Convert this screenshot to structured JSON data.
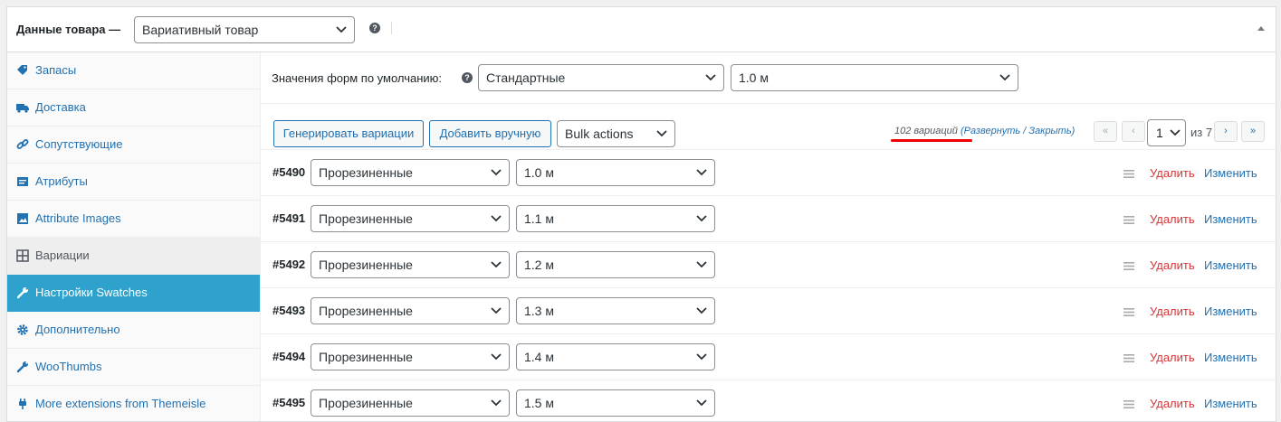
{
  "header": {
    "title": "Данные товара —",
    "type_select": "Вариативный товар",
    "help_icon": "help-icon",
    "collapse_icon": "collapse-arrow-icon"
  },
  "sidebar": {
    "items": [
      {
        "label": "Запасы",
        "icon": "inventory-tag-icon"
      },
      {
        "label": "Доставка",
        "icon": "truck-icon"
      },
      {
        "label": "Сопутствующие",
        "icon": "link-icon"
      },
      {
        "label": "Атрибуты",
        "icon": "attributes-list-icon"
      },
      {
        "label": "Attribute Images",
        "icon": "image-icon"
      },
      {
        "label": "Вариации",
        "icon": "grid-icon"
      },
      {
        "label": "Настройки Swatches",
        "icon": "wrench-icon"
      },
      {
        "label": "Дополнительно",
        "icon": "gear-icon"
      },
      {
        "label": "WooThumbs",
        "icon": "wrench-icon"
      },
      {
        "label": "More extensions from Themeisle",
        "icon": "plug-icon"
      }
    ]
  },
  "defaults": {
    "label": "Значения форм по умолчанию:",
    "select1": "Стандартные",
    "select2": "1.0 м"
  },
  "toolbar": {
    "generate_label": "Генерировать вариации",
    "add_label": "Добавить вручную",
    "bulk_label": "Bulk actions",
    "count_text": "102 вариаций",
    "expand_open": "(",
    "expand_label": "Развернуть",
    "expand_sep": " / ",
    "close_label": "Закрыть",
    "expand_close": ")",
    "first": "«",
    "prev": "‹",
    "page": "1",
    "of_text": "из 7",
    "next": "›",
    "last": "»"
  },
  "colors": {
    "accent": "#2271b1",
    "active_tab": "#2ea2cc",
    "delete": "#d63638",
    "annotation": "#ee0000"
  },
  "variations": [
    {
      "id": "#5490",
      "type": "Прорезиненные",
      "size": "1.0 м",
      "delete": "Удалить",
      "edit": "Изменить"
    },
    {
      "id": "#5491",
      "type": "Прорезиненные",
      "size": "1.1 м",
      "delete": "Удалить",
      "edit": "Изменить"
    },
    {
      "id": "#5492",
      "type": "Прорезиненные",
      "size": "1.2 м",
      "delete": "Удалить",
      "edit": "Изменить"
    },
    {
      "id": "#5493",
      "type": "Прорезиненные",
      "size": "1.3 м",
      "delete": "Удалить",
      "edit": "Изменить"
    },
    {
      "id": "#5494",
      "type": "Прорезиненные",
      "size": "1.4 м",
      "delete": "Удалить",
      "edit": "Изменить"
    },
    {
      "id": "#5495",
      "type": "Прорезиненные",
      "size": "1.5 м",
      "delete": "Удалить",
      "edit": "Изменить"
    }
  ]
}
